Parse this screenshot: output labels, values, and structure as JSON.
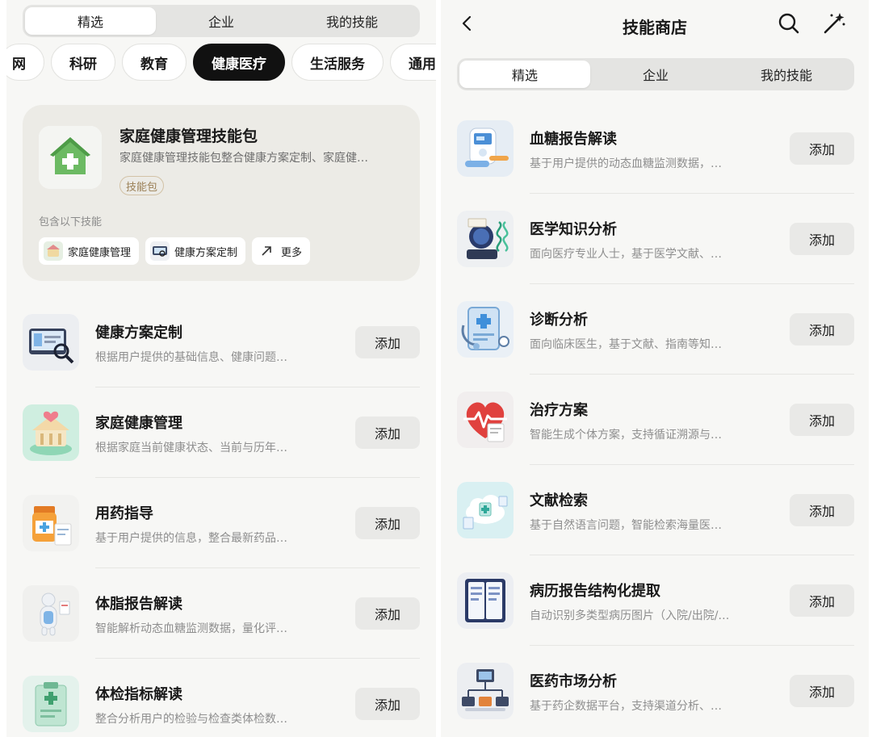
{
  "left": {
    "tabs": [
      {
        "label": "精选",
        "active": true
      },
      {
        "label": "企业",
        "active": false
      },
      {
        "label": "我的技能",
        "active": false
      }
    ],
    "categories": [
      {
        "label": "网",
        "active": false
      },
      {
        "label": "科研",
        "active": false
      },
      {
        "label": "教育",
        "active": false
      },
      {
        "label": "健康医疗",
        "active": true
      },
      {
        "label": "生活服务",
        "active": false
      },
      {
        "label": "通用工",
        "active": false
      }
    ],
    "package": {
      "icon": "house-plus-icon",
      "title": "家庭健康管理技能包",
      "desc": "家庭健康管理技能包整合健康方案定制、家庭健…",
      "tag": "技能包",
      "includes_label": "包含以下技能",
      "skills": [
        {
          "label": "家庭健康管理",
          "icon": "family-health-icon"
        },
        {
          "label": "健康方案定制",
          "icon": "health-plan-icon"
        },
        {
          "label": "更多",
          "icon": "arrow-up-right-icon"
        }
      ]
    },
    "items": [
      {
        "title": "健康方案定制",
        "desc": "根据用户提供的基础信息、健康问题…",
        "button": "添加",
        "icon": "health-plan-icon"
      },
      {
        "title": "家庭健康管理",
        "desc": "根据家庭当前健康状态、当前与历年…",
        "button": "添加",
        "icon": "family-health-icon"
      },
      {
        "title": "用药指导",
        "desc": "基于用户提供的信息，整合最新药品…",
        "button": "添加",
        "icon": "medicine-bottle-icon"
      },
      {
        "title": "体脂报告解读",
        "desc": "智能解析动态血糖监测数据，量化评…",
        "button": "添加",
        "icon": "body-fat-icon"
      },
      {
        "title": "体检指标解读",
        "desc": "整合分析用户的检验与检查类体检数…",
        "button": "添加",
        "icon": "checkup-clipboard-icon"
      }
    ]
  },
  "right": {
    "title": "技能商店",
    "tabs": [
      {
        "label": "精选",
        "active": true
      },
      {
        "label": "企业",
        "active": false
      },
      {
        "label": "我的技能",
        "active": false
      }
    ],
    "items": [
      {
        "title": "血糖报告解读",
        "desc": "基于用户提供的动态血糖监测数据，…",
        "button": "添加",
        "icon": "glucose-meter-icon"
      },
      {
        "title": "医学知识分析",
        "desc": "面向医疗专业人士，基于医学文献、…",
        "button": "添加",
        "icon": "brain-dna-icon"
      },
      {
        "title": "诊断分析",
        "desc": "面向临床医生，基于文献、指南等知…",
        "button": "添加",
        "icon": "diagnosis-tablet-icon"
      },
      {
        "title": "治疗方案",
        "desc": "智能生成个体方案，支持循证溯源与…",
        "button": "添加",
        "icon": "heart-pulse-icon"
      },
      {
        "title": "文献检索",
        "desc": "基于自然语言问题，智能检索海量医…",
        "button": "添加",
        "icon": "literature-cloud-icon"
      },
      {
        "title": "病历报告结构化提取",
        "desc": "自动识别多类型病历图片（入院/出院/…",
        "button": "添加",
        "icon": "medical-record-icon"
      },
      {
        "title": "医药市场分析",
        "desc": "基于药企数据平台，支持渠道分析、…",
        "button": "添加",
        "icon": "market-network-icon"
      }
    ]
  },
  "colors": {
    "active_chip": "#111111",
    "tag_text": "#9a7f55",
    "button_bg": "#e9e9e7"
  }
}
